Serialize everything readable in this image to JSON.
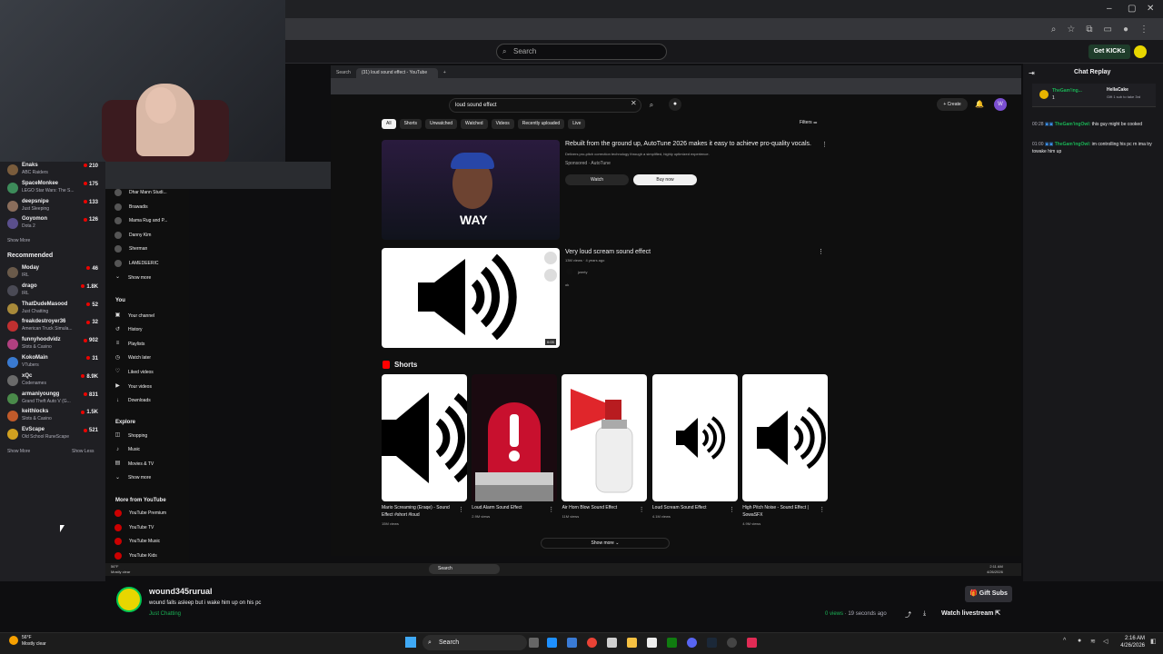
{
  "outer": {
    "twitch_search_placeholder": "Search",
    "get_kicks": "Get KICKs"
  },
  "twitch_sidebar": {
    "followed": [
      {
        "name": "Enaks",
        "game": "ABC Raiders",
        "viewers": "210",
        "color": "#7a5c3c"
      },
      {
        "name": "SpaceMonkee",
        "game": "LEGO Star Wars: The S...",
        "viewers": "175",
        "color": "#3d8b5a"
      },
      {
        "name": "deepsnipe",
        "game": "Just Sleeping",
        "viewers": "133",
        "color": "#8a6d5b"
      },
      {
        "name": "Goyomon",
        "game": "Dota 2",
        "viewers": "126",
        "color": "#5a4f8c"
      }
    ],
    "show_more": "Show More",
    "recommended_title": "Recommended",
    "recommended": [
      {
        "name": "Moday",
        "game": "IRL",
        "viewers": "46",
        "color": "#6a5a4a"
      },
      {
        "name": "drago",
        "game": "IRL",
        "viewers": "1.8K",
        "color": "#4a4a55"
      },
      {
        "name": "ThatDudeMasood",
        "game": "Just Chatting",
        "viewers": "52",
        "color": "#a88a3a"
      },
      {
        "name": "freakdestroyer36",
        "game": "American Truck Simula...",
        "viewers": "32",
        "color": "#c03030"
      },
      {
        "name": "funnyhoodvidz",
        "game": "Slots & Casino",
        "viewers": "902",
        "color": "#b04080"
      },
      {
        "name": "KokoMain",
        "game": "VTubers",
        "viewers": "31",
        "color": "#3a7ad0"
      },
      {
        "name": "xQc",
        "game": "Codenames",
        "viewers": "8.9K",
        "color": "#6a6a6a"
      },
      {
        "name": "armaniyoungg",
        "game": "Grand Theft Auto V (G...",
        "viewers": "831",
        "color": "#4a8a4a"
      },
      {
        "name": "keithlocks",
        "game": "Slots & Casino",
        "viewers": "1.5K",
        "color": "#c05a2a"
      },
      {
        "name": "EvScape",
        "game": "Old School RuneScape",
        "viewers": "521",
        "color": "#d0a020"
      }
    ],
    "show_more_2": "Show More",
    "show_less": "Show Less"
  },
  "inner_browser": {
    "tab1": "Search",
    "tab2": "(31) loud sound effect - YouTube"
  },
  "youtube": {
    "search_value": "loud sound effect",
    "create": "Create",
    "notif_count": "9+",
    "avatar_letter": "W",
    "chips": [
      "All",
      "Shorts",
      "Unwatched",
      "Watched",
      "Videos",
      "Recently uploaded",
      "Live"
    ],
    "filters": "Filters",
    "guide": {
      "subs": [
        {
          "label": "Dhar Mann Studi...",
          "color": "#444"
        },
        {
          "label": "Brawadis",
          "color": "#555"
        },
        {
          "label": "Mama Rug and P...",
          "color": "#664"
        },
        {
          "label": "Danny Kim",
          "color": "#556"
        },
        {
          "label": "Sherman",
          "color": "#465"
        },
        {
          "label": "LAMEDEERIC",
          "color": "#644"
        }
      ],
      "show_more": "Show more",
      "you": "You",
      "you_items": [
        {
          "label": "Your channel",
          "icon": "▣"
        },
        {
          "label": "History",
          "icon": "↺"
        },
        {
          "label": "Playlists",
          "icon": "≡"
        },
        {
          "label": "Watch later",
          "icon": "◷"
        },
        {
          "label": "Liked videos",
          "icon": "♡"
        },
        {
          "label": "Your videos",
          "icon": "▶"
        },
        {
          "label": "Downloads",
          "icon": "↓"
        }
      ],
      "explore": "Explore",
      "explore_items": [
        {
          "label": "Shopping",
          "icon": "◫"
        },
        {
          "label": "Music",
          "icon": "♪"
        },
        {
          "label": "Movies & TV",
          "icon": "▤"
        },
        {
          "label": "Show more",
          "icon": "⌄"
        }
      ],
      "more_from": "More from YouTube",
      "more_items": [
        "YouTube Premium",
        "YouTube TV",
        "YouTube Music",
        "YouTube Kids"
      ]
    },
    "ad": {
      "title": "Rebuilt from the ground up, AutoTune 2026 makes it easy to achieve pro-quality vocals.",
      "desc": "Delivers pro-pitch correction technology through a simplified, highly optimized experience.",
      "sponsored": "Sponsored · AutoTune",
      "logo_text": "WAY",
      "watch": "Watch",
      "buy": "Buy now"
    },
    "video1": {
      "title": "Very loud scream sound effect",
      "meta": "13M views · 4 years ago",
      "channel": "jwerty",
      "desc": "ok",
      "duration": "0:03"
    },
    "shorts_title": "Shorts",
    "shorts": [
      {
        "title": "Mario Screaming (Eraqe) - Sound Effect #short #loud",
        "views": "15M views"
      },
      {
        "title": "Loud Alarm Sound Effect",
        "views": "2.9M views"
      },
      {
        "title": "Air Horn Blow Sound Effect",
        "views": "11M views"
      },
      {
        "title": "Loud Scream Sound Effect",
        "views": "4.1M views"
      },
      {
        "title": "High Pitch Noise - Sound Effect | SowaSFX",
        "views": "4.9M views"
      }
    ],
    "show_more": "Show more"
  },
  "inner_taskbar": {
    "temp": "56°F",
    "cond": "Mostly clear",
    "search": "Search",
    "time": "2:11 AM",
    "date": "4/26/2026"
  },
  "chat": {
    "title": "Chat Replay",
    "gifter": "TheGam'ing...",
    "gift_count": "1",
    "gift_user": "HellaCake",
    "gift_text": "Gift 1 sub to take 3rd",
    "messages": [
      {
        "time": "00:28",
        "user": "TheGam'ingOwl:",
        "text": "this guy might be cooked"
      },
      {
        "time": "01:00",
        "user": "TheGam'ingOwl:",
        "text": "im controlling his pc rn ima try towake him up"
      }
    ]
  },
  "stream": {
    "name": "wound345rurual",
    "title": "wound falls asleep but i wake him up on his pc",
    "category": "Just Chatting",
    "views": "0 views",
    "ago": " · 19 seconds ago",
    "gift_subs": "Gift Subs",
    "watch_live": "Watch livestream"
  },
  "taskbar": {
    "temp": "56°F",
    "cond": "Mostly clear",
    "search": "Search",
    "time": "2:16 AM",
    "date": "4/26/2026"
  },
  "colors": {
    "twitch_green": "#1ab255",
    "youtube_red": "#ff0000",
    "live_red": "#eb0400"
  }
}
